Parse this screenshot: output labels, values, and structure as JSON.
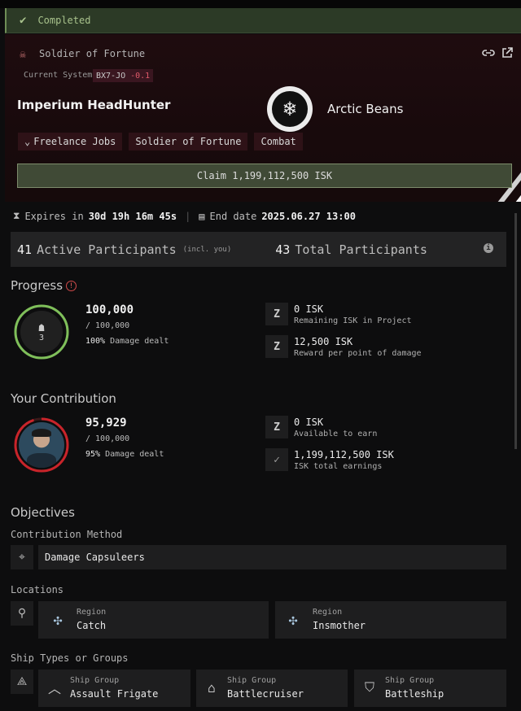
{
  "status": {
    "label": "Completed"
  },
  "header": {
    "category": "Soldier of Fortune",
    "system_label": "Current System",
    "system_name": "BX7-JO",
    "system_security": "-0.1",
    "title": "Imperium HeadHunter",
    "corp_name": "Arctic Beans",
    "tags": [
      "Freelance Jobs",
      "Soldier of Fortune",
      "Combat"
    ],
    "claim_label": "Claim 1,199,112,500 ISK"
  },
  "timer": {
    "expires_label": "Expires in",
    "expires_value": "30d 19h 16m 45s",
    "end_label": "End date",
    "end_value": "2025.06.27 13:00"
  },
  "participants": {
    "active_count": "41",
    "active_label": "Active Participants",
    "active_note": "(incl. you)",
    "total_count": "43",
    "total_label": "Total Participants"
  },
  "progress": {
    "title": "Progress",
    "participants_icon_count": "3",
    "current": "100,000",
    "target": "/ 100,000",
    "percent_label": "100%",
    "percent_suffix": "Damage dealt",
    "remaining_value": "0 ISK",
    "remaining_label": "Remaining ISK in Project",
    "reward_value": "12,500 ISK",
    "reward_label": "Reward per point of damage",
    "fraction": 1.0
  },
  "contribution": {
    "title": "Your Contribution",
    "current": "95,929",
    "target": "/ 100,000",
    "percent_label": "95%",
    "percent_suffix": "Damage dealt",
    "available_value": "0 ISK",
    "available_label": "Available to earn",
    "earnings_value": "1,199,112,500 ISK",
    "earnings_label": "ISK total earnings",
    "fraction": 0.95
  },
  "objectives": {
    "title": "Objectives",
    "method_label": "Contribution Method",
    "method_value": "Damage Capsuleers",
    "locations_label": "Locations",
    "locations": [
      {
        "caption": "Region",
        "name": "Catch"
      },
      {
        "caption": "Region",
        "name": "Insmother"
      }
    ],
    "ships_label": "Ship Types or Groups",
    "ships": [
      {
        "caption": "Ship Group",
        "name": "Assault Frigate"
      },
      {
        "caption": "Ship Group",
        "name": "Battlecruiser"
      },
      {
        "caption": "Ship Group",
        "name": "Battleship"
      }
    ]
  },
  "colors": {
    "completed_green": "#a8c28c",
    "progress_ring": "#7fbf5a",
    "contribution_ring": "#c8242a",
    "header_bg": "#1f0c0f"
  }
}
